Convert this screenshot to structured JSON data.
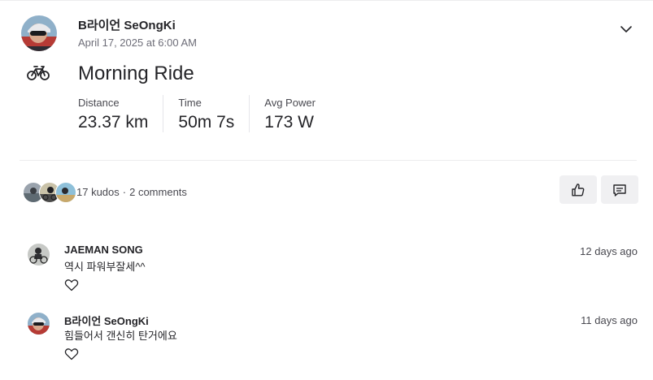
{
  "activity": {
    "athlete_name": "B라이언 SeOngKi",
    "date": "April 17, 2025 at 6:00 AM",
    "title": "Morning Ride",
    "sport_icon": "bike-icon"
  },
  "stats": [
    {
      "label": "Distance",
      "value": "23.37 km"
    },
    {
      "label": "Time",
      "value": "50m 7s"
    },
    {
      "label": "Avg Power",
      "value": "173 W"
    }
  ],
  "social": {
    "kudos": "17 kudos",
    "separator": "·",
    "comments": "2 comments"
  },
  "comments": [
    {
      "name": "JAEMAN SONG",
      "text": "역시 파워부잘세^^",
      "time": "12 days ago"
    },
    {
      "name": "B라이언 SeOngKi",
      "text": "힘들어서 갠신히 탄거에요",
      "time": "11 days ago"
    }
  ],
  "colors": {
    "text_primary": "#242428",
    "text_secondary": "#6d6d78",
    "button_bg": "#f0f0f2",
    "divider": "#ececee"
  }
}
